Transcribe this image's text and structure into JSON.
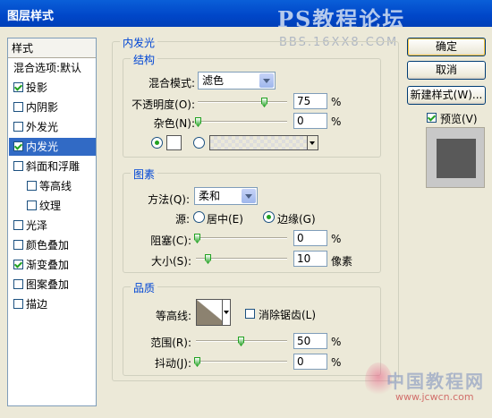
{
  "window": {
    "title": "图层样式"
  },
  "watermark": {
    "line1": "PS教程论坛",
    "line2": "BBS.16XX8.COM",
    "line3": "中国教程网",
    "line4": "www.jcwcn.com"
  },
  "styles_list": {
    "header": "样式",
    "items": [
      {
        "label": "混合选项:默认",
        "checkbox": false,
        "checked": false,
        "selected": false,
        "indent": false
      },
      {
        "label": "投影",
        "checkbox": true,
        "checked": true,
        "selected": false,
        "indent": false
      },
      {
        "label": "内阴影",
        "checkbox": true,
        "checked": false,
        "selected": false,
        "indent": false
      },
      {
        "label": "外发光",
        "checkbox": true,
        "checked": false,
        "selected": false,
        "indent": false
      },
      {
        "label": "内发光",
        "checkbox": true,
        "checked": true,
        "selected": true,
        "indent": false
      },
      {
        "label": "斜面和浮雕",
        "checkbox": true,
        "checked": false,
        "selected": false,
        "indent": false
      },
      {
        "label": "等高线",
        "checkbox": true,
        "checked": false,
        "selected": false,
        "indent": true
      },
      {
        "label": "纹理",
        "checkbox": true,
        "checked": false,
        "selected": false,
        "indent": true
      },
      {
        "label": "光泽",
        "checkbox": true,
        "checked": false,
        "selected": false,
        "indent": false
      },
      {
        "label": "颜色叠加",
        "checkbox": true,
        "checked": false,
        "selected": false,
        "indent": false
      },
      {
        "label": "渐变叠加",
        "checkbox": true,
        "checked": true,
        "selected": false,
        "indent": false
      },
      {
        "label": "图案叠加",
        "checkbox": true,
        "checked": false,
        "selected": false,
        "indent": false
      },
      {
        "label": "描边",
        "checkbox": true,
        "checked": false,
        "selected": false,
        "indent": false
      }
    ]
  },
  "panel": {
    "title": "内发光",
    "structure": {
      "legend": "结构",
      "blend_mode_label": "混合模式:",
      "blend_mode_value": "滤色",
      "opacity_label": "不透明度(O):",
      "opacity_value": "75",
      "opacity_unit": "%",
      "noise_label": "杂色(N):",
      "noise_value": "0",
      "noise_unit": "%"
    },
    "elements": {
      "legend": "图素",
      "method_label": "方法(Q):",
      "method_value": "柔和",
      "source_label": "源:",
      "source_center": "居中(E)",
      "source_edge": "边缘(G)",
      "choke_label": "阻塞(C):",
      "choke_value": "0",
      "choke_unit": "%",
      "size_label": "大小(S):",
      "size_value": "10",
      "size_unit": "像素"
    },
    "quality": {
      "legend": "品质",
      "contour_label": "等高线:",
      "antialias_label": "消除锯齿(L)",
      "range_label": "范围(R):",
      "range_value": "50",
      "range_unit": "%",
      "jitter_label": "抖动(J):",
      "jitter_value": "0",
      "jitter_unit": "%"
    }
  },
  "buttons": {
    "ok": "确定",
    "cancel": "取消",
    "new_style": "新建样式(W)...",
    "preview_label": "预览(V)"
  },
  "colors": {
    "accent": "#0046d5",
    "selection": "#316ac5",
    "titlebar": "#0046c8",
    "preview_shape": "#595959"
  }
}
